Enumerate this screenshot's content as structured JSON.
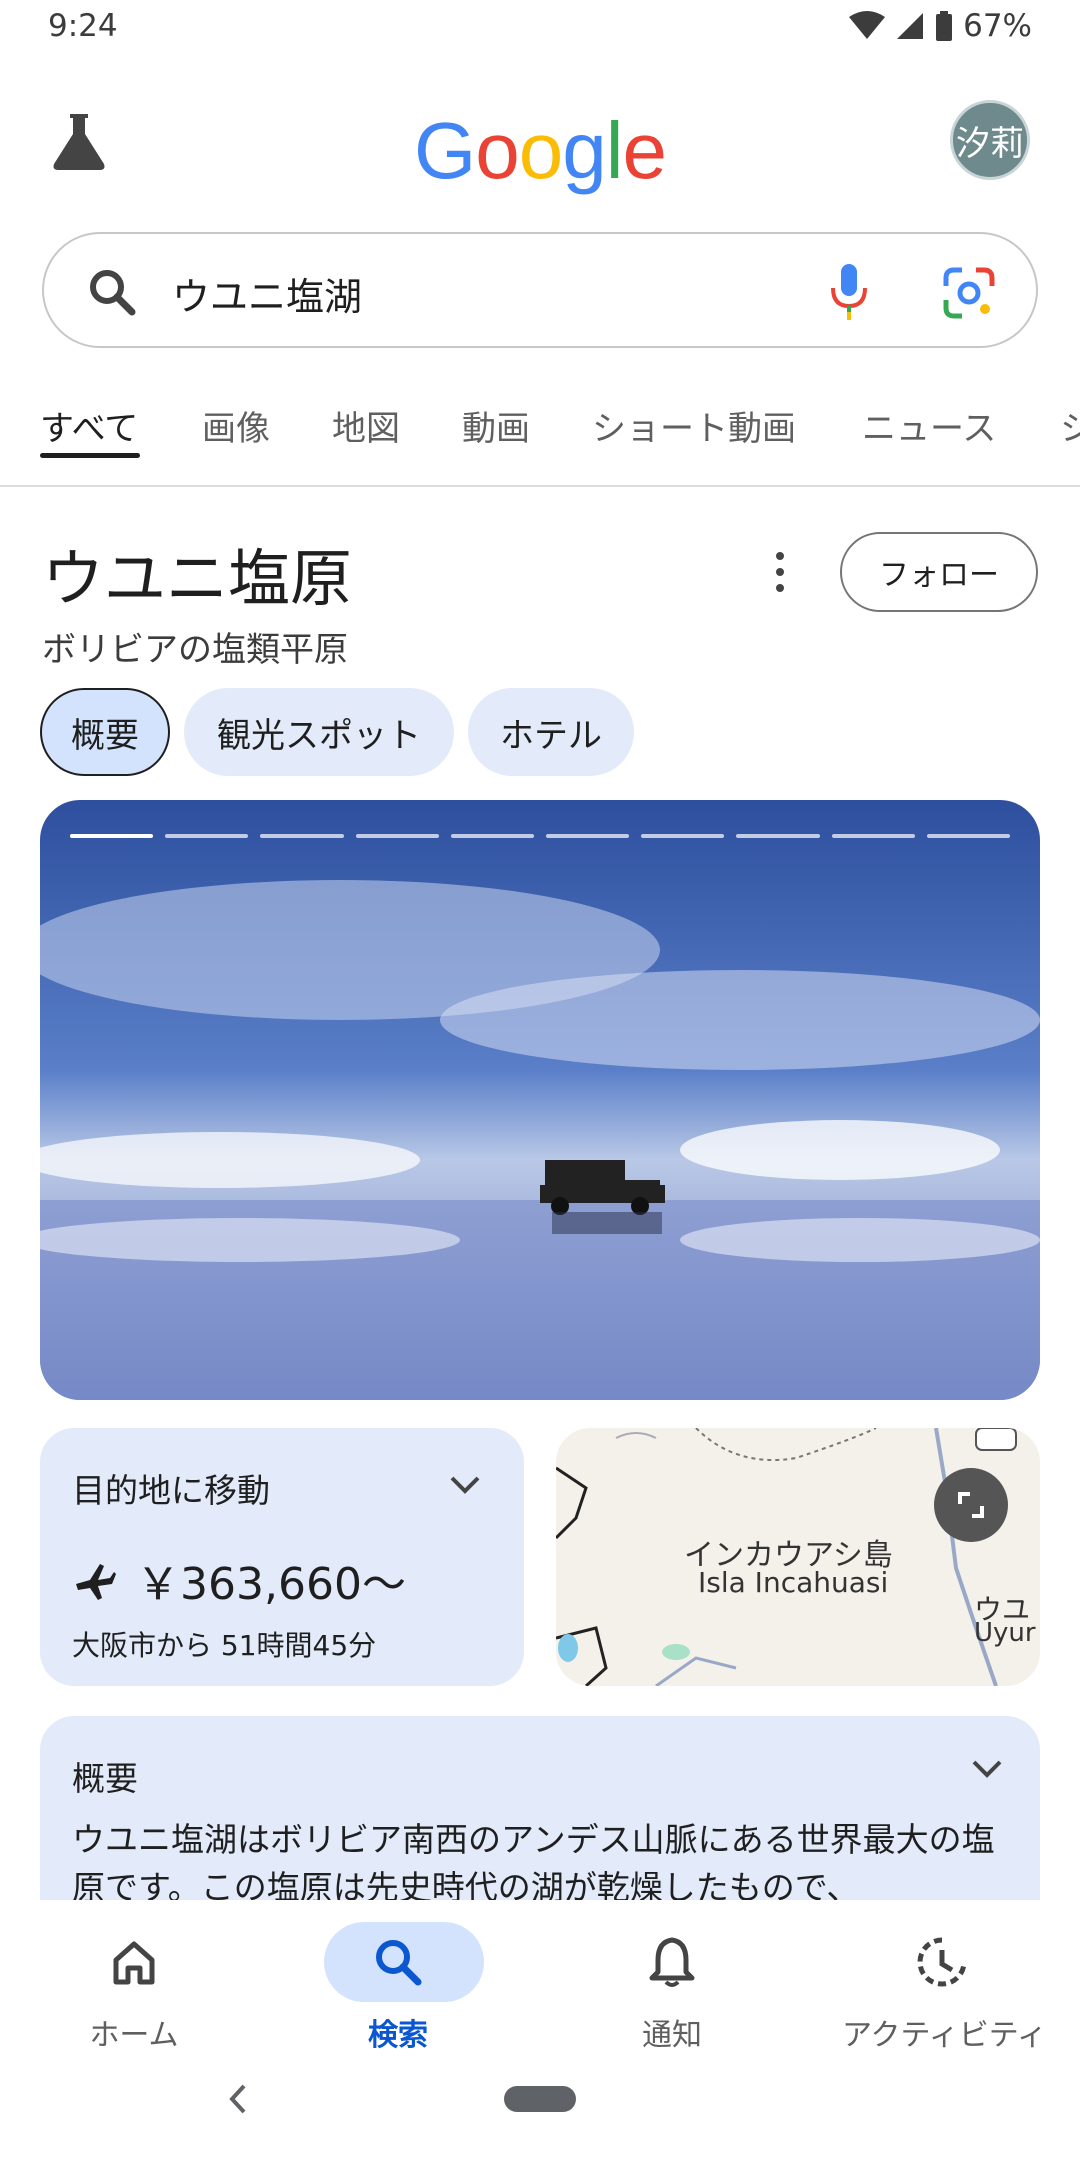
{
  "status": {
    "time": "9:24",
    "battery": "67%"
  },
  "header": {
    "logo": "Google",
    "avatar_text": "汐莉"
  },
  "search": {
    "query": "ウユニ塩湖"
  },
  "tabs": [
    "すべて",
    "画像",
    "地図",
    "動画",
    "ショート動画",
    "ニュース",
    "シ"
  ],
  "knowledge": {
    "title": "ウユニ塩原",
    "subtitle": "ボリビアの塩類平原",
    "follow_label": "フォロー",
    "chips": [
      "概要",
      "観光スポット",
      "ホテル"
    ]
  },
  "travel": {
    "label": "目的地に移動",
    "price": "￥363,660〜",
    "from": "大阪市から 51時間45分"
  },
  "map": {
    "place_ja": "インカウアシ島",
    "place_en": "Isla Incahuasi",
    "edge_ja": "ウユ",
    "edge_en": "Uyur"
  },
  "overview": {
    "label": "概要",
    "text": "ウユニ塩湖はボリビア南西のアンデス山脈にある世界最大の塩原です。この塩原は先史時代の湖が乾燥したもので、"
  },
  "bottom_nav": [
    {
      "label": "ホーム",
      "icon": "home-icon"
    },
    {
      "label": "検索",
      "icon": "search-icon"
    },
    {
      "label": "通知",
      "icon": "bell-icon"
    },
    {
      "label": "アクティビティ",
      "icon": "activity-icon"
    }
  ],
  "colors": {
    "accent": "#0b57d0",
    "chip_bg": "#e3ebfa",
    "chip_active": "#d3e3fd"
  }
}
